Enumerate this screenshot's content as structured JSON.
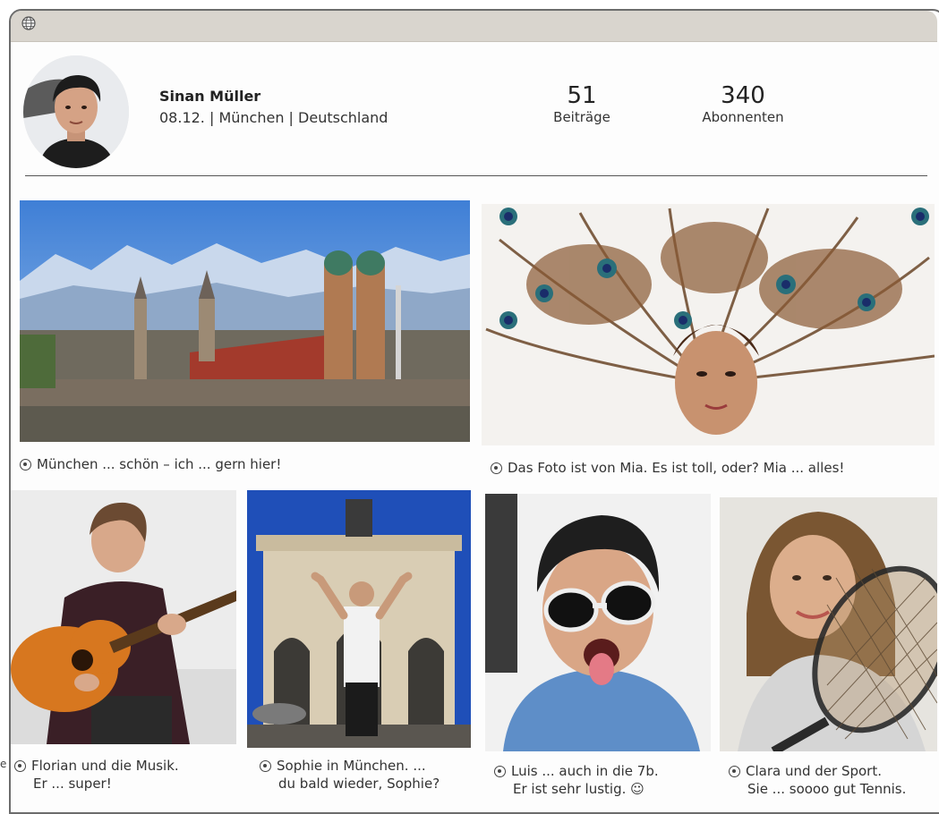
{
  "profile": {
    "name": "Sinan Müller",
    "details": "08.12. | München | Deutschland",
    "posts_count": "51",
    "posts_label": "Beiträge",
    "followers_count": "340",
    "followers_label": "Abonnenten"
  },
  "posts": [
    {
      "caption_line1": "München ... schön – ich ... gern hier!"
    },
    {
      "caption_line1": "Das Foto ist von Mia. Es ist toll, oder? Mia ... alles!"
    },
    {
      "caption_line1": "Florian und die Musik.",
      "caption_line2": "Er ... super!"
    },
    {
      "caption_line1": "Sophie in München. ...",
      "caption_line2": "du bald wieder, Sophie?"
    },
    {
      "caption_line1": "Luis ... auch in die 7b.",
      "caption_line2": "Er ist sehr lustig. ☺"
    },
    {
      "caption_line1": "Clara und der Sport.",
      "caption_line2": "Sie ... soooo gut Tennis."
    }
  ],
  "edge_fragment": "e",
  "icons": {
    "window": "globe-icon",
    "caption": "location-icon"
  },
  "colors": {
    "titlebar": "#d9d5ce",
    "divider": "#555555",
    "sky": "#4a86d8"
  }
}
